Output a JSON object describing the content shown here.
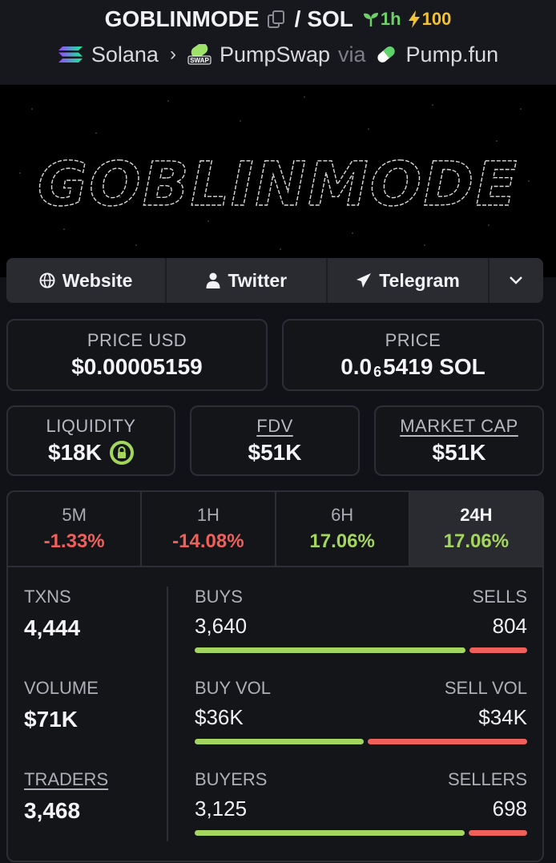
{
  "header": {
    "token": "GOBLINMODE",
    "separator": "/",
    "quote": "SOL",
    "age": "1h",
    "boost": "100",
    "chain": "Solana",
    "dex": "PumpSwap",
    "via": "via",
    "launchpad": "Pump.fun"
  },
  "banner": {
    "text": "GOBLINMODE"
  },
  "links": {
    "website": "Website",
    "twitter": "Twitter",
    "telegram": "Telegram"
  },
  "prices": {
    "usd_label": "PRICE USD",
    "usd_value": "$0.00005159",
    "native_label": "PRICE",
    "native_prefix": "0.0",
    "native_zeros": "6",
    "native_suffix": "5419 SOL"
  },
  "caps": {
    "liquidity_label": "LIQUIDITY",
    "liquidity_value": "$18K",
    "fdv_label": "FDV",
    "fdv_value": "$51K",
    "mcap_label": "MARKET CAP",
    "mcap_value": "$51K"
  },
  "tabs": [
    {
      "label": "5M",
      "value": "-1.33%"
    },
    {
      "label": "1H",
      "value": "-14.08%"
    },
    {
      "label": "6H",
      "value": "17.06%"
    },
    {
      "label": "24H",
      "value": "17.06%"
    }
  ],
  "metrics": {
    "txns_label": "TXNS",
    "txns_value": "4,444",
    "volume_label": "VOLUME",
    "volume_value": "$71K",
    "traders_label": "TRADERS",
    "traders_value": "3,468"
  },
  "splits": {
    "buys_label": "BUYS",
    "buys_value": "3,640",
    "sells_label": "SELLS",
    "sells_value": "804",
    "buyvol_label": "BUY VOL",
    "buyvol_value": "$36K",
    "sellvol_label": "SELL VOL",
    "sellvol_value": "$34K",
    "buyers_label": "BUYERS",
    "buyers_value": "3,125",
    "sellers_label": "SELLERS",
    "sellers_value": "698"
  },
  "split_ratios": {
    "txns": 0.819,
    "volume": 0.514,
    "traders": 0.817
  },
  "colors": {
    "positive": "#a4d55e",
    "negative": "#f0605a",
    "accent_boost": "#f1c232"
  }
}
